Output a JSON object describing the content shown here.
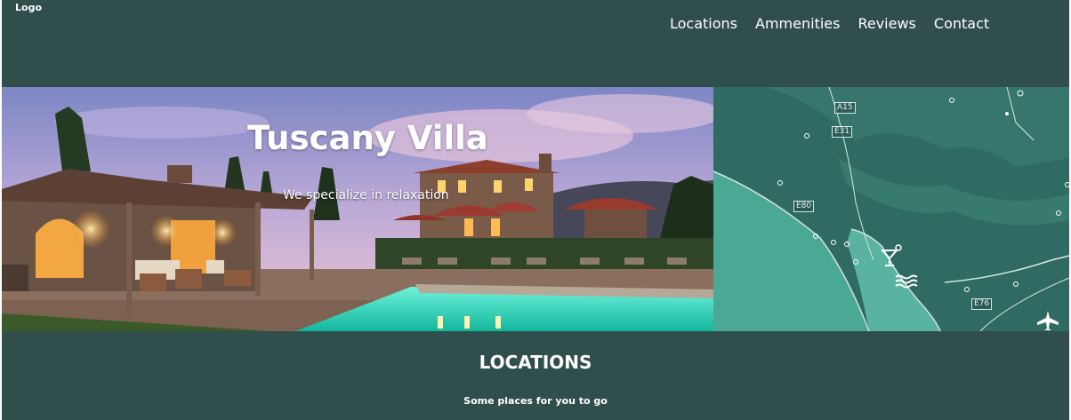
{
  "header": {
    "logo": "Logo",
    "nav": [
      "Locations",
      "Ammenities",
      "Reviews",
      "Contact"
    ]
  },
  "hero": {
    "title": "Tuscany Villa",
    "subtitle": "We specialize in relaxation"
  },
  "map": {
    "road_labels": [
      "A15",
      "E31",
      "E80",
      "E76"
    ]
  },
  "locations": {
    "title": "LOCATIONS",
    "subtitle": "Some places for you to go"
  },
  "colors": {
    "background": "#2f4e4c",
    "map_land": "#2f6b62",
    "map_sea": "#4aa895",
    "pool": "#3fe0c4"
  }
}
